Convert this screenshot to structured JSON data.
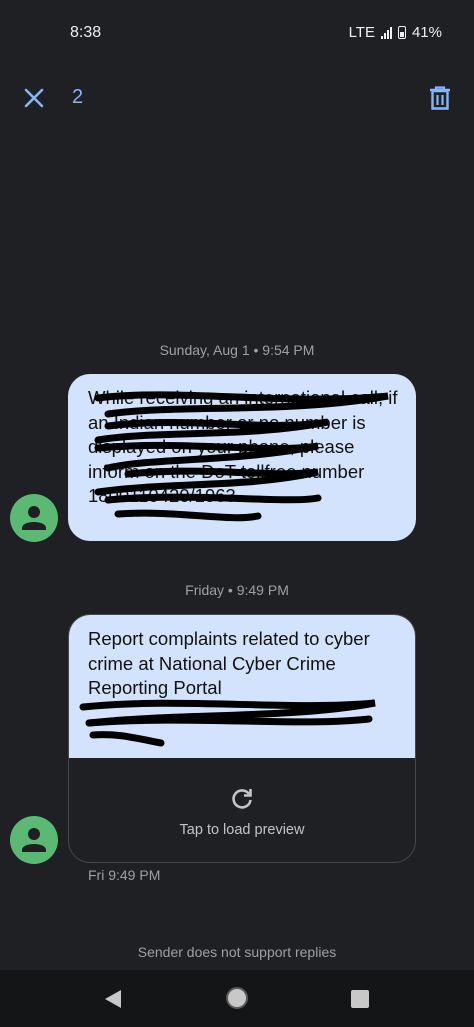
{
  "status": {
    "time": "8:38",
    "network": "LTE",
    "battery": "41%",
    "icons": [
      "signal-icon",
      "battery-icon"
    ]
  },
  "header": {
    "selected_count": "2",
    "icons": [
      "close-icon",
      "delete-icon"
    ]
  },
  "messages": [
    {
      "date_label": "Sunday, Aug 1 • 9:54 PM",
      "text": "While receiving an international call, if an Indian number or no number is displayed on your phone, please inform on the DoT tollfree number 1800110420/1963."
    },
    {
      "date_label": "Friday • 9:49 PM",
      "text": "Report complaints related to cyber crime at National Cyber Crime Reporting Portal",
      "preview_label": "Tap to load preview",
      "time": "Fri 9:49 PM"
    }
  ],
  "footer": {
    "note": "Sender does not support replies"
  },
  "nav": {
    "icons": [
      "back-icon",
      "home-icon",
      "recents-icon"
    ]
  },
  "colors": {
    "background": "#1f2024",
    "bubble": "#d3e3fd",
    "accent": "#8ab4f8",
    "avatar": "#5bb974"
  }
}
